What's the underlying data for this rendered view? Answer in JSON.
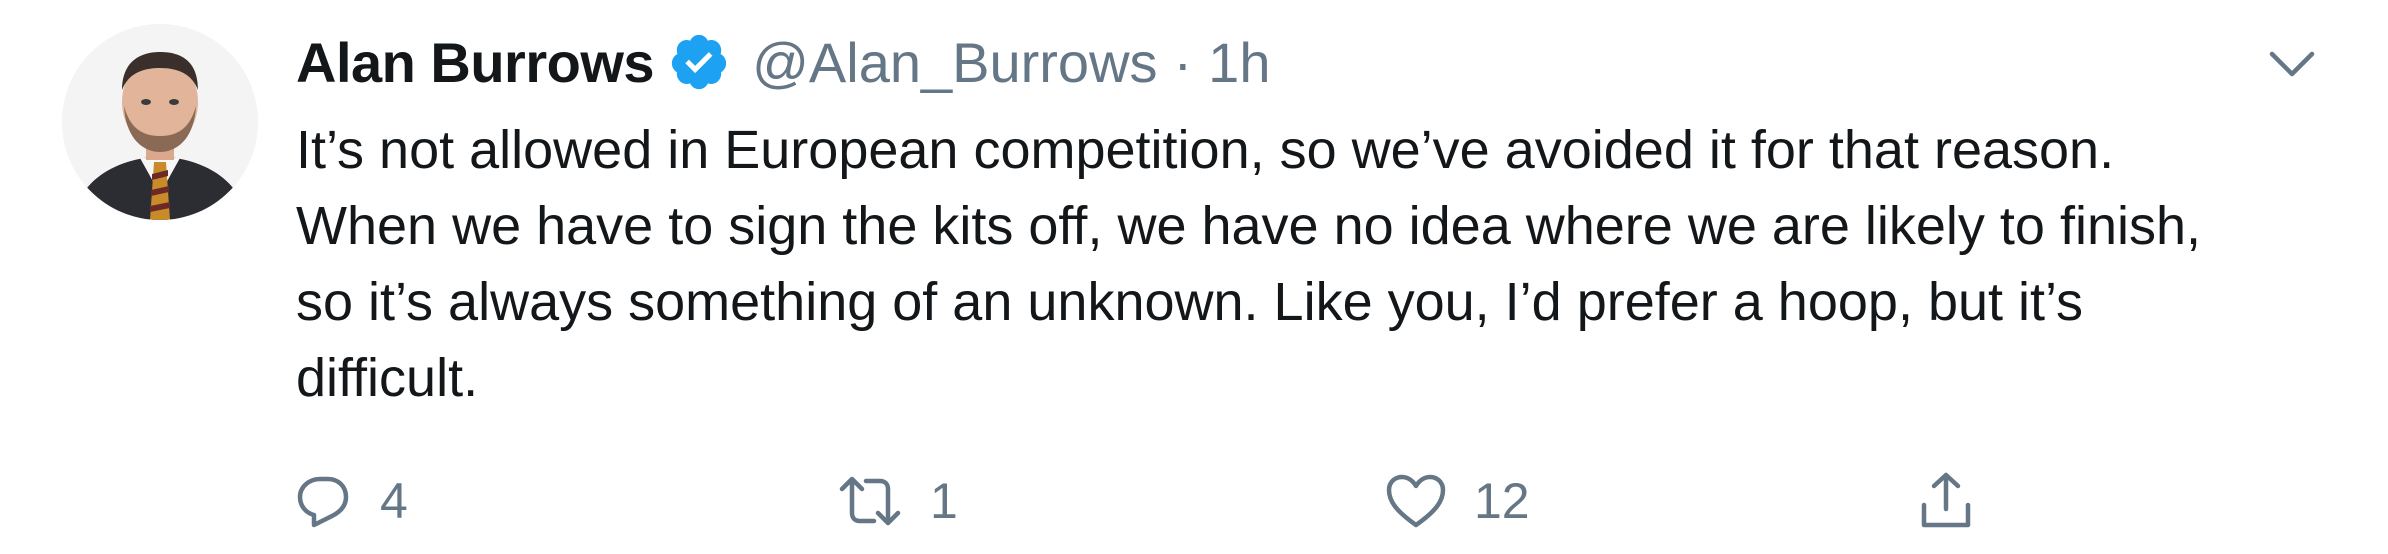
{
  "tweet": {
    "author": {
      "display_name": "Alan Burrows",
      "verified": true,
      "handle": "@Alan_Burrows",
      "separator": "·",
      "time": "1h",
      "avatar_icon": "profile-photo"
    },
    "text": "It’s not allowed in European competition, so we’ve avoided it for that reason.\nWhen we have to sign the kits off, we have no idea where we are likely to finish,\nso it’s always something of an unknown. Like you, I’d prefer a hoop, but it’s\ndifficult.",
    "actions": {
      "reply": {
        "icon": "reply-icon",
        "count": "4"
      },
      "retweet": {
        "icon": "retweet-icon",
        "count": "1"
      },
      "like": {
        "icon": "heart-icon",
        "count": "12"
      },
      "share": {
        "icon": "share-icon"
      }
    },
    "menu_icon": "chevron-down-icon"
  },
  "colors": {
    "text_primary": "#14171a",
    "text_secondary": "#657786",
    "verified_blue": "#1da1f2",
    "background": "#ffffff"
  }
}
